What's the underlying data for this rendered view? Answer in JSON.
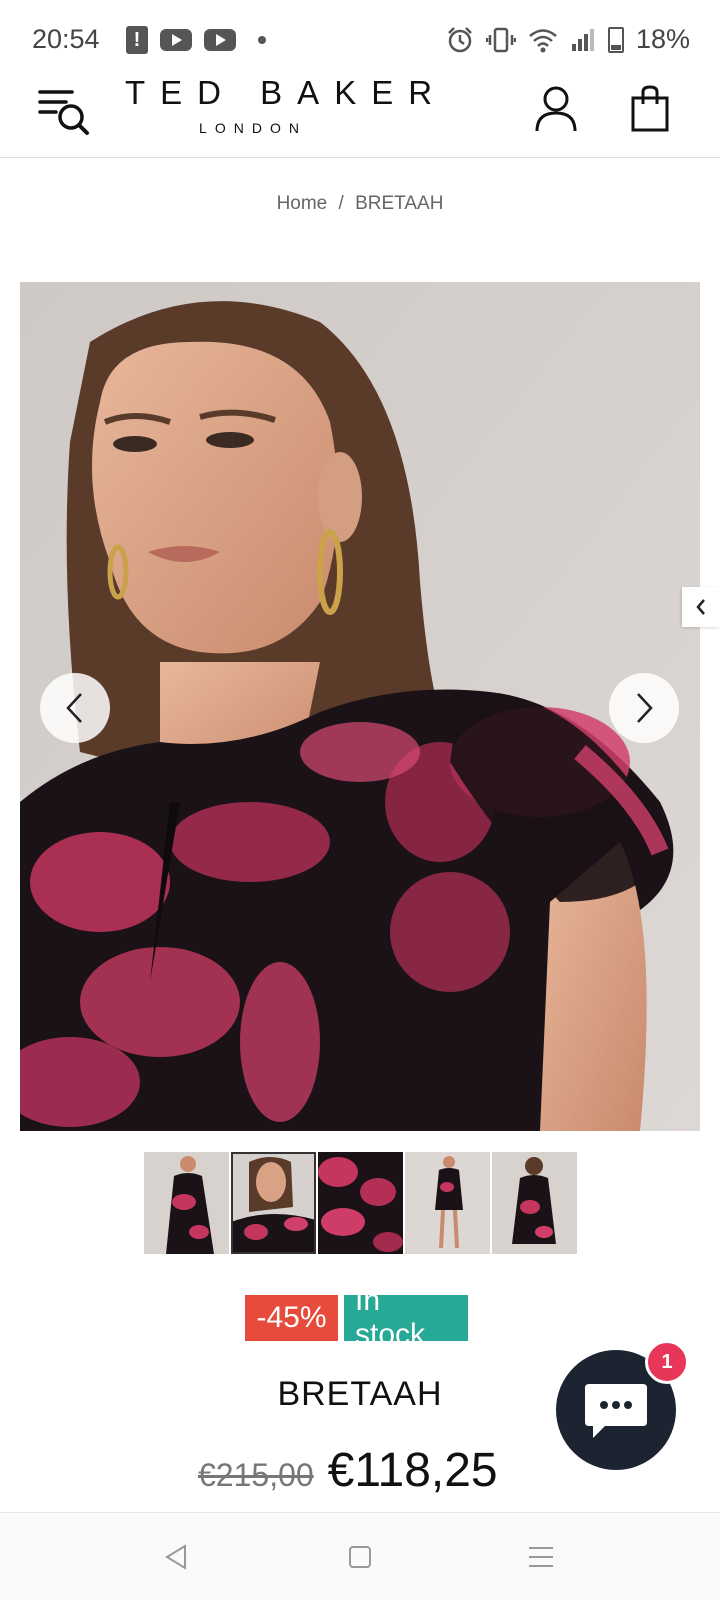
{
  "status_bar": {
    "time": "20:54",
    "battery": "18%"
  },
  "header": {
    "brand": "TED BAKER",
    "brand_sub": "LONDON",
    "icons": [
      "menu-search-icon",
      "account-icon",
      "shopping-bag-icon"
    ]
  },
  "breadcrumb": {
    "home": "Home",
    "separator": "/",
    "current": "BRETAAH"
  },
  "gallery": {
    "thumbnail_count": 5,
    "active_index": 1
  },
  "product": {
    "discount_badge": "-45%",
    "stock_badge": "In stock",
    "title": "BRETAAH",
    "old_price": "€215,00",
    "price": "€118,25"
  },
  "chat": {
    "unread_count": "1"
  },
  "colors": {
    "discount": "#e64b3c",
    "stock": "#27a996",
    "chat": "#1c2431",
    "chat_badge": "#e8365a"
  }
}
